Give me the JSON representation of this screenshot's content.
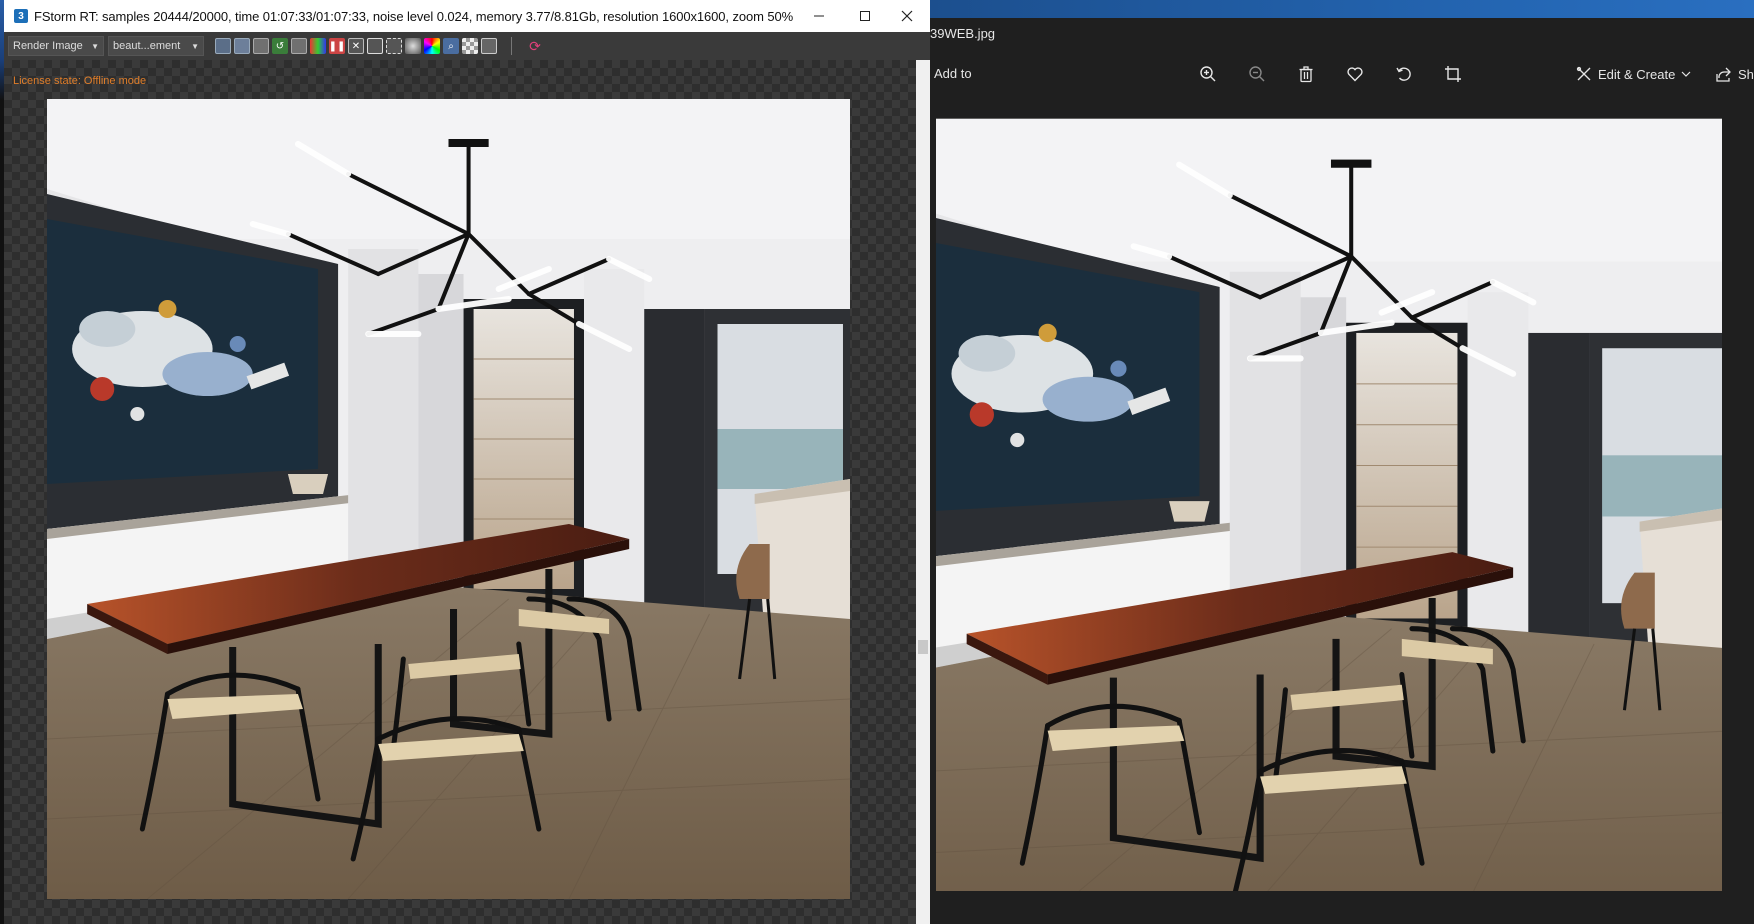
{
  "fstorm": {
    "title": "FStorm RT: samples 20444/20000,  time 01:07:33/01:07:33,  noise level 0.024,  memory 3.77/8.81Gb,  resolution 1600x1600,  zoom 50%",
    "app_icon_glyph": "3",
    "window_controls": {
      "minimize": "minimize-icon",
      "maximize": "maximize-icon",
      "close": "close-icon"
    },
    "toolbar": {
      "render_dropdown": "Render Image",
      "elements_dropdown": "beaut...ement",
      "icons": [
        "save-icon",
        "copy-icon",
        "history-icon",
        "undo-icon",
        "clone-icon",
        "color-icon",
        "pause-icon",
        "fit-icon",
        "frame-icon",
        "region-icon",
        "wheel-icon",
        "spectrum-icon",
        "zoom-icon",
        "checker-icon",
        "settings-icon",
        "refresh-icon"
      ]
    },
    "license_state": "License state: Offline mode"
  },
  "photos": {
    "filename": "39WEB.jpg",
    "add_to": "Add to",
    "toolbar_icons": [
      "zoom-in-icon",
      "zoom-out-icon",
      "delete-icon",
      "heart-icon",
      "rotate-icon",
      "crop-icon"
    ],
    "edit_create": "Edit & Create",
    "share": "Sh"
  },
  "colors": {
    "license_orange": "#e07e2a",
    "photos_bg": "#1f1f1f",
    "fstorm_toolbar": "#3a3a3a"
  }
}
